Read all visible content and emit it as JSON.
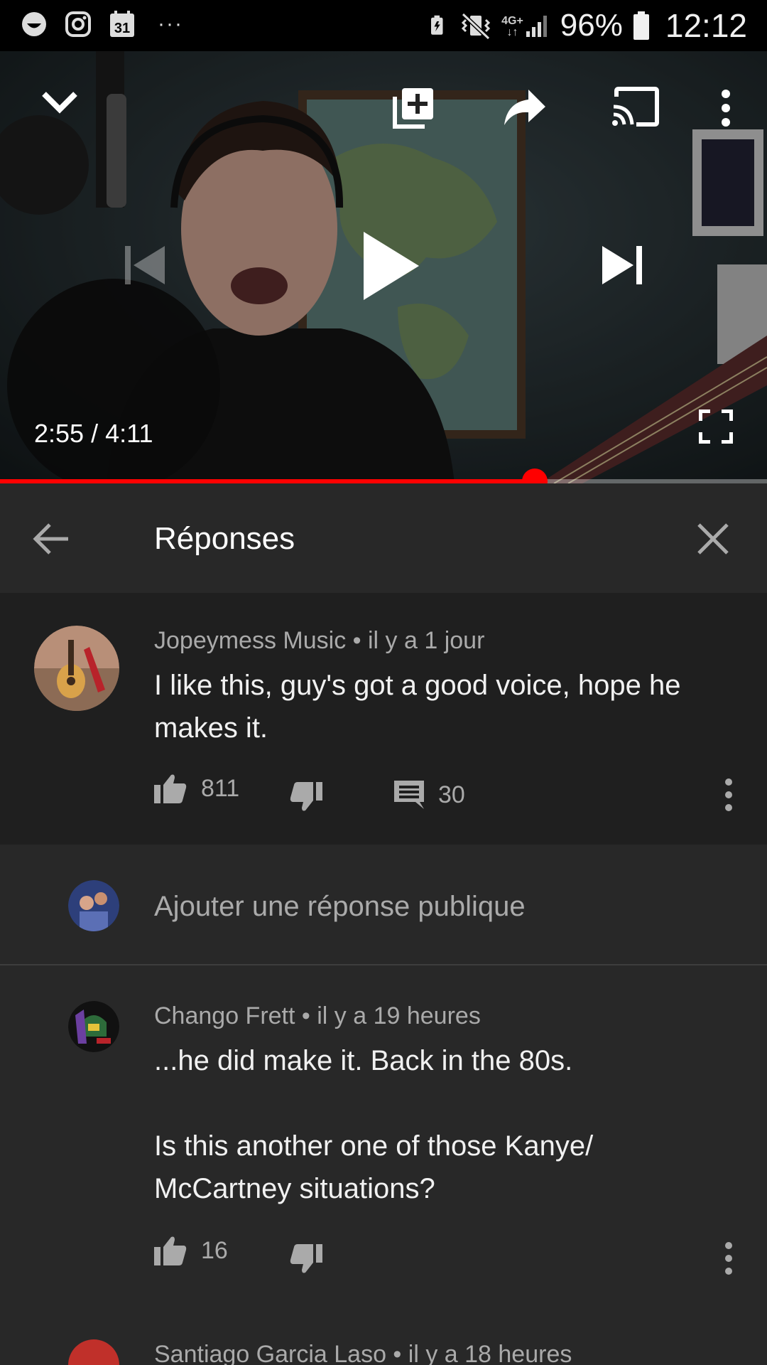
{
  "status_bar": {
    "calendar_day": "31",
    "more": "···",
    "network": "4G+",
    "battery": "96%",
    "time": "12:12"
  },
  "player": {
    "current_time": "2:55",
    "duration": "4:11",
    "time_display": "2:55 / 4:11",
    "progress": 0.697,
    "accent": "#ff0000"
  },
  "header": {
    "title": "Réponses"
  },
  "parent_comment": {
    "author": "Jopeymess Music",
    "age": "il y a 1 jour",
    "meta": "Jopeymess Music • il y a 1 jour",
    "text": "I like this, guy's got a good voice, hope he makes it.",
    "likes": "811",
    "replies": "30"
  },
  "reply_box": {
    "placeholder": "Ajouter une réponse publique"
  },
  "replies": [
    {
      "author": "Chango Frett",
      "age": "il y a 19 heures",
      "meta": "Chango Frett • il y a 19 heures",
      "text": "...he did make it.  Back in the 80s.\n\nIs this another one of those Kanye/\nMcCartney situations?",
      "likes": "16"
    },
    {
      "author": "Santiago Garcia Laso",
      "age": "il y a 18 heures",
      "meta": "Santiago Garcia Laso • il y a 18 heures"
    }
  ]
}
